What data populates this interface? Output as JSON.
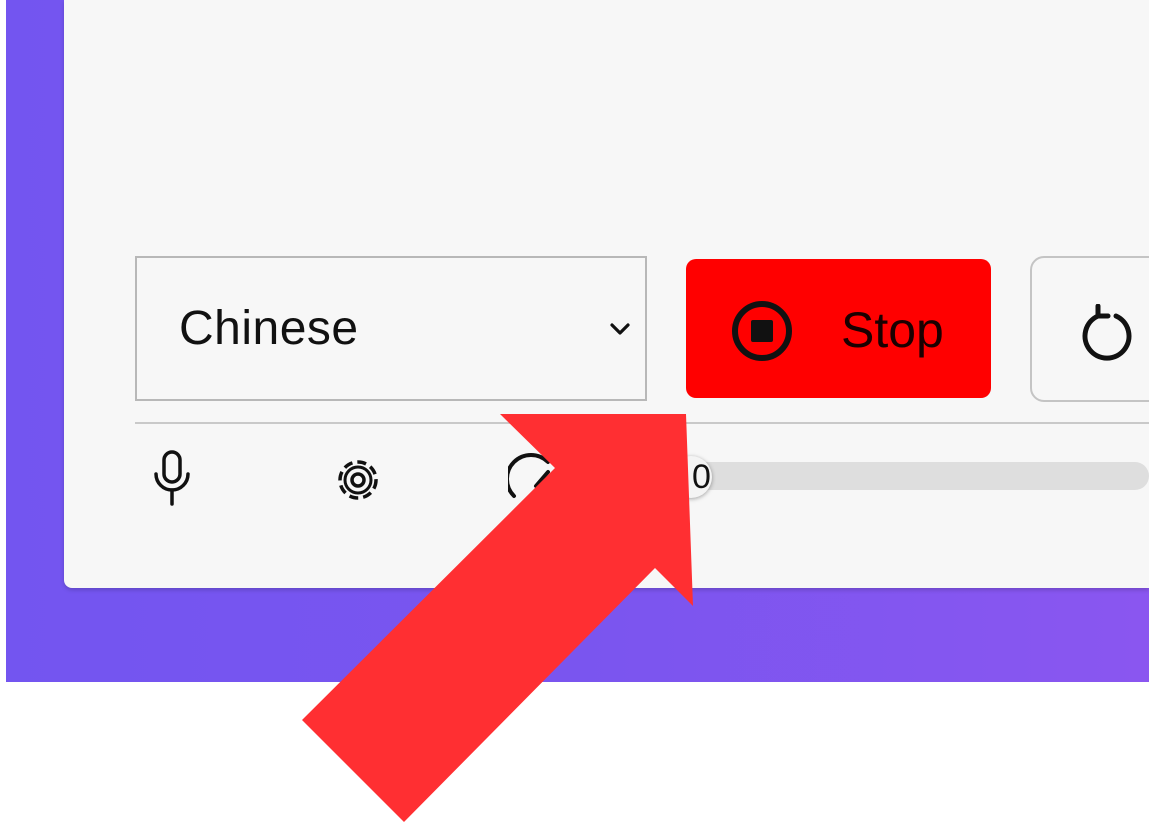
{
  "language_select": {
    "value": "Chinese"
  },
  "stop_button": {
    "label": "Stop",
    "color": "#ff0000"
  },
  "slider": {
    "value": "0"
  },
  "icons": {
    "mic": "microphone-icon",
    "settings": "gear-icon",
    "speed": "speed-icon",
    "stop": "stop-circle-icon",
    "reset": "refresh-icon",
    "dropdown": "chevron-down-icon"
  },
  "colors": {
    "background": "#7a55ef",
    "panel": "#f7f7f7",
    "annotation_arrow": "#ff2f32"
  }
}
